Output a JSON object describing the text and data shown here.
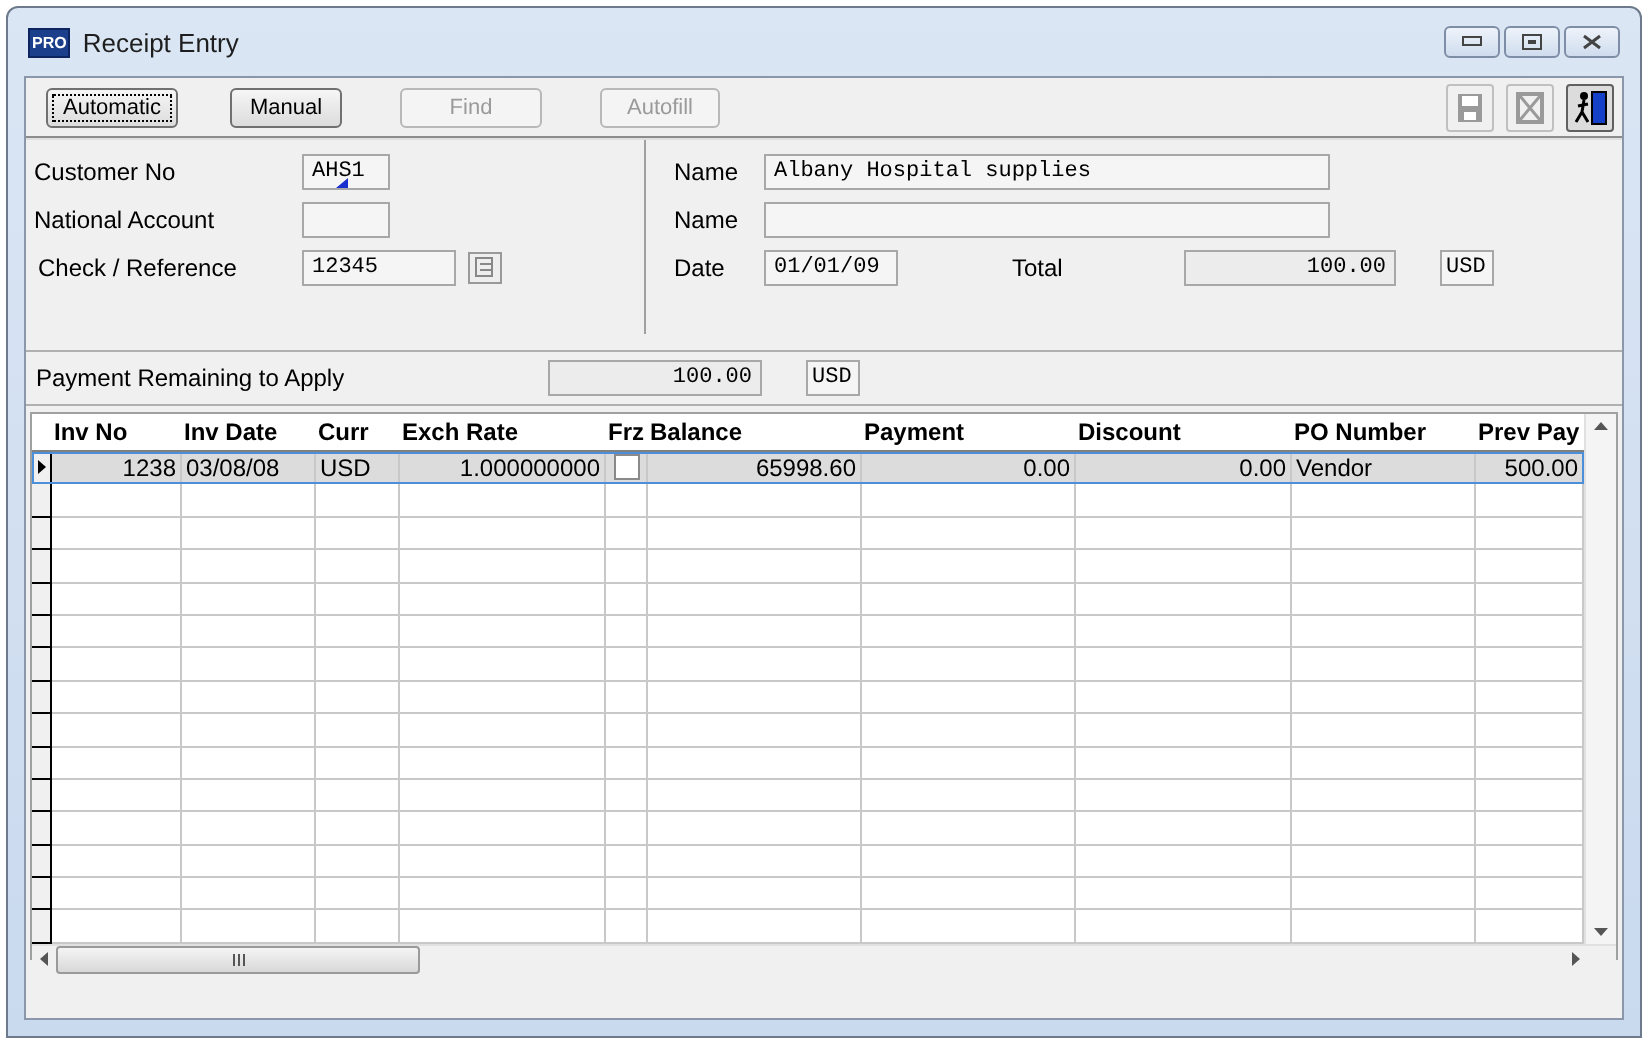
{
  "window": {
    "title": "Receipt Entry",
    "logo": "PRO"
  },
  "toolbar": {
    "buttons": [
      {
        "label": "Automatic",
        "disabled": false,
        "focused": true
      },
      {
        "label": "Manual",
        "disabled": false,
        "focused": false
      },
      {
        "label": "Find",
        "disabled": true,
        "focused": false
      },
      {
        "label": "Autofill",
        "disabled": true,
        "focused": false
      }
    ],
    "icons": [
      {
        "kind": "save",
        "disabled": true
      },
      {
        "kind": "delete",
        "disabled": true
      },
      {
        "kind": "exit",
        "disabled": false
      }
    ]
  },
  "customer": {
    "customer_no_label": "Customer No",
    "customer_no": "AHS1",
    "national_account_label": "National Account",
    "check_label": "Check / Reference",
    "check": "12345"
  },
  "details": {
    "name_label": "Name",
    "name": "Albany Hospital supplies",
    "name2_label": "Name",
    "date_label": "Date",
    "date": "01/01/09",
    "total_label": "Total",
    "total": "100.00",
    "currency": "USD"
  },
  "remaining": {
    "label": "Payment Remaining to Apply",
    "amount": "100.00",
    "currency": "USD"
  },
  "table": {
    "columns": [
      "Inv No",
      "Inv Date",
      "Curr",
      "Exch Rate",
      "Frz",
      "Balance",
      "Payment",
      "Discount",
      "PO Number",
      "Prev Pay"
    ],
    "rows": [
      {
        "selected": true,
        "inv_no": "1238",
        "inv_date": "03/08/08",
        "curr": "USD",
        "exch_rate": "1.000000000",
        "frz": false,
        "balance": "65998.60",
        "payment": "0.00",
        "discount": "0.00",
        "po_number": "Vendor",
        "prev_pay": "500.00"
      }
    ]
  }
}
